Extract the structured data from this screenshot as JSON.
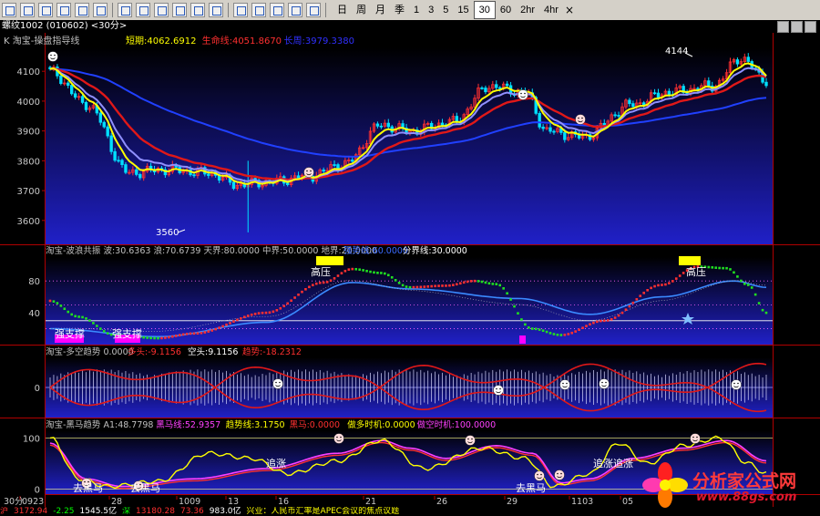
{
  "toolbar": {
    "periods": [
      "日",
      "周",
      "月",
      "季",
      "1",
      "3",
      "5",
      "15",
      "30",
      "60",
      "2hr",
      "4hr"
    ],
    "active_period": "30",
    "close_glyph": "×"
  },
  "titlebar": {
    "text": "螺纹1002 (010602) <30分>"
  },
  "panels": {
    "main": {
      "indicator": "K 淘宝-操盘指导线",
      "legend": [
        {
          "label": "短期:4062.6912",
          "color": "#ffff00"
        },
        {
          "label": "生命线:4051.8670",
          "color": "#ff3030"
        },
        {
          "label": "长周:3979.3380",
          "color": "#3030ff"
        }
      ],
      "y_ticks": [
        "4100",
        "4000",
        "3900",
        "3800",
        "3700",
        "3600"
      ],
      "high_label": "4144",
      "low_label": "3560"
    },
    "p2": {
      "legend": [
        {
          "label": "淘宝-波浪共振 波:30.6363 浪:70.6739 天界:80.0000 中界:50.0000 地界:20.0000",
          "color": "#c0c0c0"
        },
        {
          "label": "强势线:60.0000",
          "color": "#3a6aff"
        },
        {
          "label": "分界线:30.0000",
          "color": "#ffffff"
        }
      ],
      "y_ticks": [
        "80",
        "40"
      ],
      "labels": [
        "高压",
        "高压",
        "强支撑",
        "强支撑"
      ]
    },
    "p3": {
      "legend": [
        {
          "label": "淘宝-多空趋势 0.0000",
          "color": "#c0c0c0"
        },
        {
          "label": "多头:-9.1156",
          "color": "#ff3030"
        },
        {
          "label": "空头:9.1156",
          "color": "#ffffff"
        },
        {
          "label": "趋势:-18.2312",
          "color": "#ff3030"
        }
      ],
      "y_ticks": [
        "0"
      ]
    },
    "p4": {
      "legend": [
        {
          "label": "淘宝-黑马趋势 A1:48.7798",
          "color": "#c0c0c0"
        },
        {
          "label": "黑马线:52.9357",
          "color": "#ff40ff"
        },
        {
          "label": "趋势线:3.1750",
          "color": "#ffff00"
        },
        {
          "label": "黑马:0.0000",
          "color": "#ff3030"
        },
        {
          "label": "做多时机:0.0000",
          "color": "#ffff00"
        },
        {
          "label": "做空时机:100.0000",
          "color": "#ff40ff"
        }
      ],
      "y_ticks": [
        "100",
        "0"
      ],
      "labels": [
        "追涨",
        "追涨追涨",
        "去黑马",
        "去黑马",
        "去黑马"
      ]
    }
  },
  "x_axis": {
    "labels": [
      "30分",
      "0923",
      "28",
      "1009",
      "13",
      "16",
      "21",
      "26",
      "29",
      "1103",
      "05"
    ]
  },
  "status_bar": [
    {
      "label": "沪",
      "color": "#ff3030"
    },
    {
      "label": "3172.94",
      "color": "#ff3030"
    },
    {
      "label": "-2.25",
      "color": "#00ff00"
    },
    {
      "label": "1545.5亿",
      "color": "#ffffff"
    },
    {
      "label": "深",
      "color": "#00ff00"
    },
    {
      "label": "13180.28",
      "color": "#ff3030"
    },
    {
      "label": "73.36",
      "color": "#ff3030"
    },
    {
      "label": "983.0亿",
      "color": "#ffffff"
    },
    {
      "label": "兴业：人民币汇率是APEC会议的焦点议题",
      "color": "#ffff00"
    }
  ],
  "logo": {
    "title": "分析家公式网",
    "url": "www.88gs.com"
  },
  "colors": {
    "bull": "#ff3030",
    "bear": "#00e0ff",
    "short": "#ffff00",
    "life": "#e01818",
    "long": "#2040ff",
    "mid": "#9090ff"
  }
}
